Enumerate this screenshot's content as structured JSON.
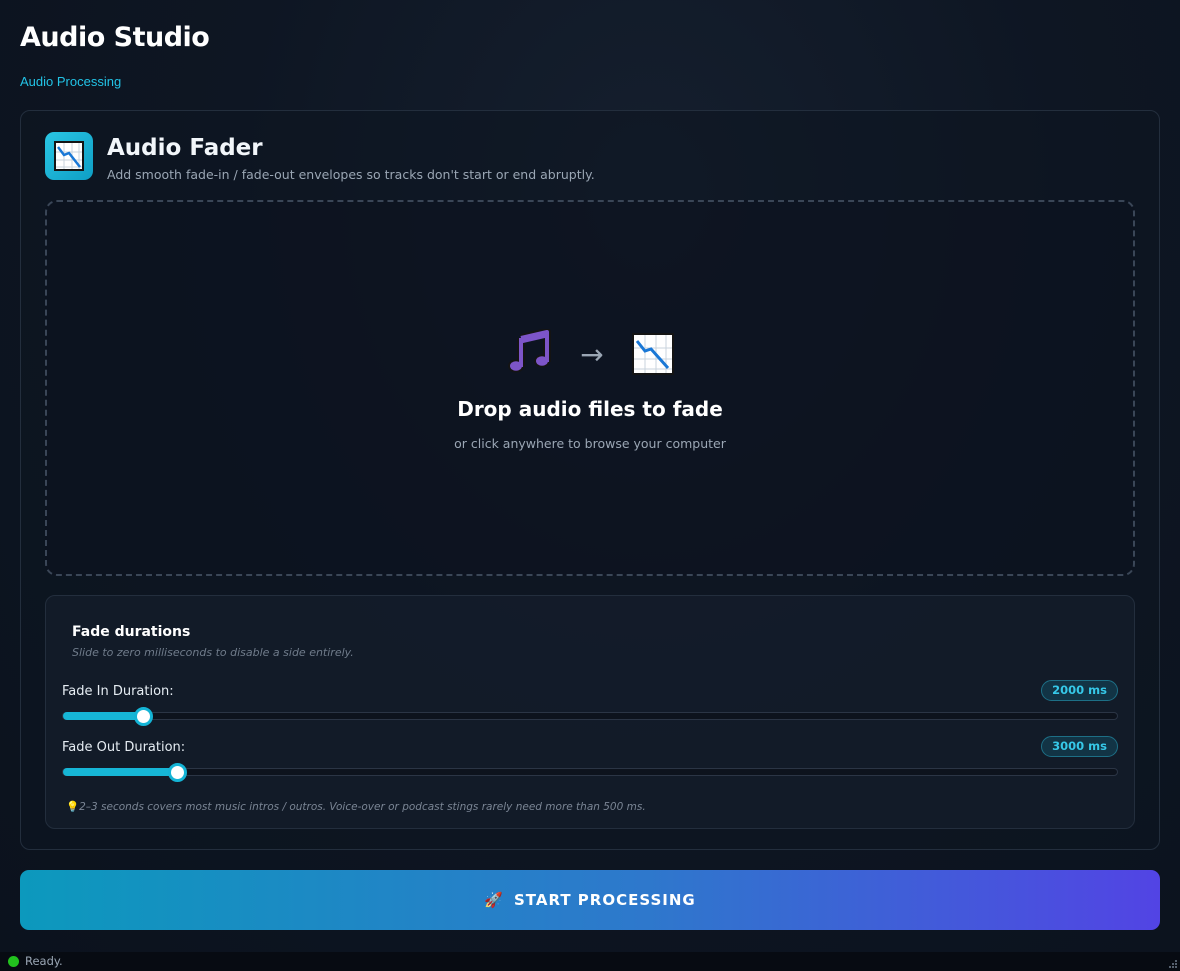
{
  "app": {
    "title": "Audio Studio",
    "subtitle": "Audio Processing"
  },
  "tool": {
    "icon": "chart-decreasing-icon",
    "title": "Audio Fader",
    "description": "Add smooth fade-in / fade-out envelopes so tracks don't start or end abruptly."
  },
  "dropzone": {
    "icons": [
      "music-note-icon",
      "arrow-right-icon",
      "chart-decreasing-icon"
    ],
    "arrow": "→",
    "title": "Drop audio files to fade",
    "hint": "or click anywhere to browse your computer"
  },
  "settings": {
    "title": "Fade durations",
    "note": "Slide to zero milliseconds to disable a side entirely.",
    "fade_in": {
      "label": "Fade In Duration:",
      "value_text": "2000 ms",
      "fraction": 0.076
    },
    "fade_out": {
      "label": "Fade Out Duration:",
      "value_text": "3000 ms",
      "fraction": 0.108
    },
    "tip_icon": "💡",
    "tip": "2–3 seconds covers most music intros / outros. Voice-over or podcast stings rarely need more than 500 ms."
  },
  "start_button": {
    "icon": "🚀",
    "label": "START PROCESSING"
  },
  "status": {
    "text": "Ready.",
    "color": "#22c21e"
  },
  "colors": {
    "accent": "#16b6d6",
    "button_gradient_start": "#0c99bd",
    "button_gradient_end": "#5244e4"
  }
}
